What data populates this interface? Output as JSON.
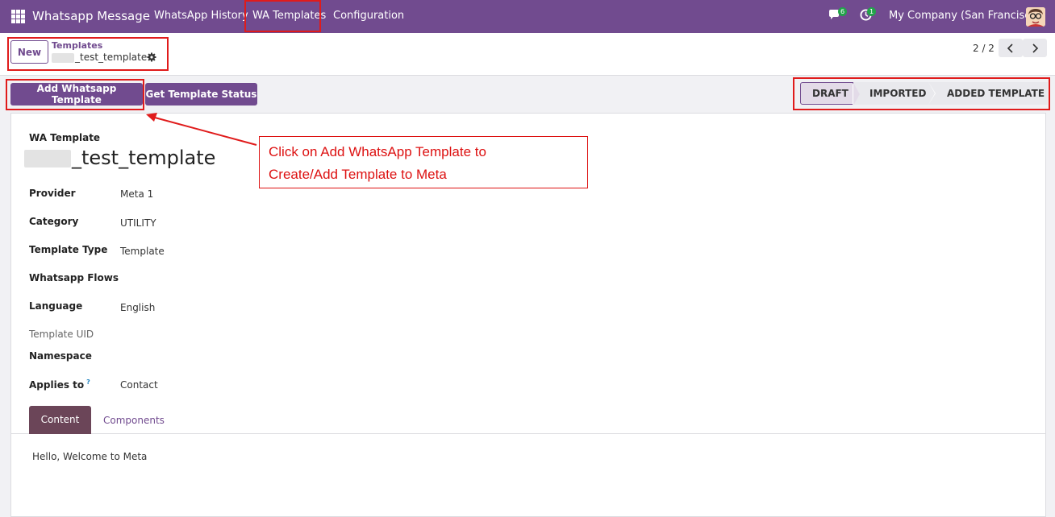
{
  "navbar": {
    "app_name": "Whatsapp Message",
    "menu": [
      "WhatsApp History",
      "WA Templates",
      "Configuration"
    ],
    "chat_badge": "6",
    "activity_badge": "1",
    "company": "My Company (San Francisco)",
    "color": "#714b8f"
  },
  "control": {
    "new_label": "New",
    "breadcrumb_parent": "Templates",
    "breadcrumb_current": "_test_template",
    "pager": "2 / 2"
  },
  "actions": {
    "add_label": "Add Whatsapp Template",
    "status_label": "Get Template Status"
  },
  "statusbar": [
    "DRAFT",
    "IMPORTED",
    "ADDED TEMPLATE"
  ],
  "form": {
    "wa_template_label": "WA Template",
    "title": "_test_template",
    "fields": [
      {
        "label": "Provider",
        "value": "Meta 1"
      },
      {
        "label": "Category",
        "value": "UTILITY"
      },
      {
        "label": "Template Type",
        "value": "Template"
      },
      {
        "label": "Whatsapp Flows",
        "value": ""
      },
      {
        "label": "Language",
        "value": "English"
      },
      {
        "label": "Template UID",
        "value": ""
      },
      {
        "label": "Namespace",
        "value": ""
      },
      {
        "label": "Applies to",
        "value": "Contact"
      }
    ],
    "applies_help": "?"
  },
  "tabs": [
    "Content",
    "Components"
  ],
  "content_text": "Hello, Welcome to Meta",
  "annotation": {
    "line1": "Click on Add WhatsApp Template to",
    "line2": "Create/Add Template to Meta"
  }
}
